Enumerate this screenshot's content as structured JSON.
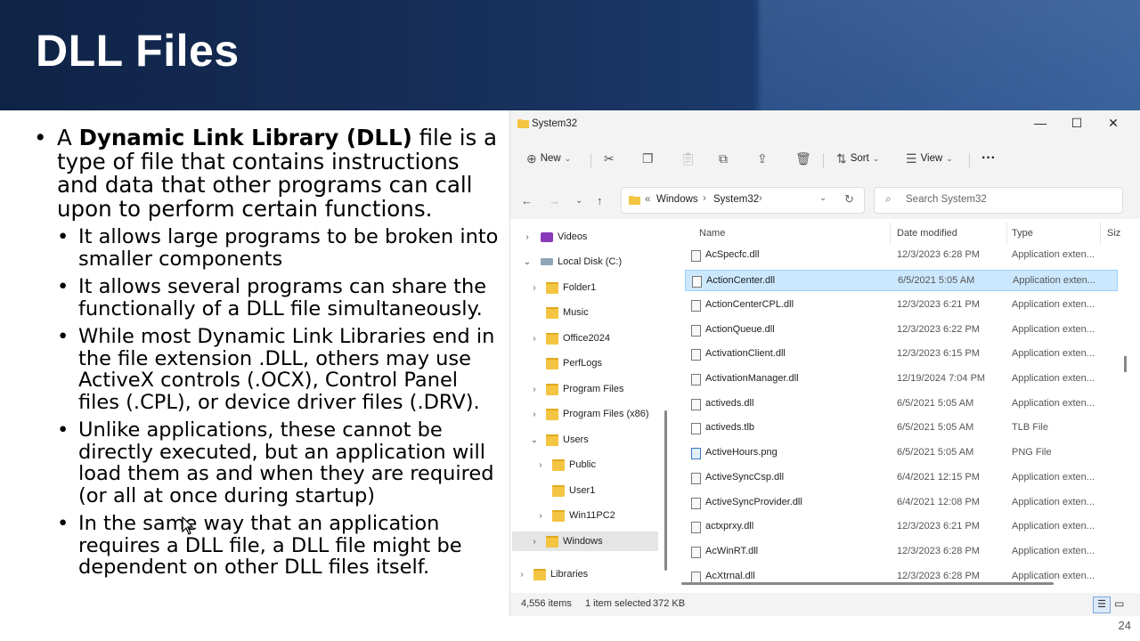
{
  "slide": {
    "title": "DLL Files",
    "page_number": "24",
    "bullets": [
      {
        "level": 1,
        "prefix": "A ",
        "bold": "Dynamic Link Library (DLL)",
        "text": " file is a type of file that contains instructions and data that other programs can call upon to perform certain functions."
      },
      {
        "level": 2,
        "text": "It allows large programs to be broken into smaller components"
      },
      {
        "level": 2,
        "text": "It allows several programs can share the functionally of a DLL file simultaneously."
      },
      {
        "level": 2,
        "text": "While most Dynamic Link Libraries end in the file extension .DLL, others may use ActiveX controls (.OCX), Control Panel files (.CPL), or device driver files (.DRV)."
      },
      {
        "level": 2,
        "text": "Unlike applications, these cannot be directly executed, but an application will load them as and when they are required (or all at once during startup)"
      },
      {
        "level": 2,
        "text": "In the same way that an application requires a DLL file, a DLL file might be dependent on other DLL files itself."
      }
    ]
  },
  "explorer": {
    "window_title": "System32",
    "toolbar": {
      "new": "New",
      "sort": "Sort",
      "view": "View",
      "more": "···"
    },
    "address": {
      "overflow": "«",
      "crumbs": [
        "Windows",
        "System32"
      ]
    },
    "search_placeholder": "Search System32",
    "tree": [
      {
        "label": "Videos",
        "depth": 0,
        "chev": "›",
        "icon": "video"
      },
      {
        "label": "Local Disk (C:)",
        "depth": 0,
        "chev": "⌄",
        "icon": "drive"
      },
      {
        "label": "Folder1",
        "depth": 1,
        "chev": "›",
        "icon": "folder"
      },
      {
        "label": "Music",
        "depth": 1,
        "chev": "",
        "icon": "folder"
      },
      {
        "label": "Office2024",
        "depth": 1,
        "chev": "›",
        "icon": "folder"
      },
      {
        "label": "PerfLogs",
        "depth": 1,
        "chev": "",
        "icon": "folder"
      },
      {
        "label": "Program Files",
        "depth": 1,
        "chev": "›",
        "icon": "folder"
      },
      {
        "label": "Program Files (x86)",
        "depth": 1,
        "chev": "›",
        "icon": "folder"
      },
      {
        "label": "Users",
        "depth": 1,
        "chev": "⌄",
        "icon": "folder"
      },
      {
        "label": "Public",
        "depth": 2,
        "chev": "›",
        "icon": "folder"
      },
      {
        "label": "User1",
        "depth": 2,
        "chev": "",
        "icon": "folder"
      },
      {
        "label": "Win11PC2",
        "depth": 2,
        "chev": "›",
        "icon": "folder"
      },
      {
        "label": "Windows",
        "depth": 1,
        "chev": "›",
        "icon": "folder",
        "selected": true
      },
      {
        "label": "Libraries",
        "depth": 0,
        "chev": "›",
        "icon": "folder"
      }
    ],
    "columns": [
      "Name",
      "Date modified",
      "Type",
      "Siz"
    ],
    "files": [
      {
        "name": "AcSpecfc.dll",
        "date": "12/3/2023 6:28 PM",
        "type": "Application exten..."
      },
      {
        "name": "ActionCenter.dll",
        "date": "6/5/2021 5:05 AM",
        "type": "Application exten...",
        "selected": true
      },
      {
        "name": "ActionCenterCPL.dll",
        "date": "12/3/2023 6:21 PM",
        "type": "Application exten..."
      },
      {
        "name": "ActionQueue.dll",
        "date": "12/3/2023 6:22 PM",
        "type": "Application exten..."
      },
      {
        "name": "ActivationClient.dll",
        "date": "12/3/2023 6:15 PM",
        "type": "Application exten..."
      },
      {
        "name": "ActivationManager.dll",
        "date": "12/19/2024 7:04 PM",
        "type": "Application exten..."
      },
      {
        "name": "activeds.dll",
        "date": "6/5/2021 5:05 AM",
        "type": "Application exten..."
      },
      {
        "name": "activeds.tlb",
        "date": "6/5/2021 5:05 AM",
        "type": "TLB File"
      },
      {
        "name": "ActiveHours.png",
        "date": "6/5/2021 5:05 AM",
        "type": "PNG File"
      },
      {
        "name": "ActiveSyncCsp.dll",
        "date": "6/4/2021 12:15 PM",
        "type": "Application exten..."
      },
      {
        "name": "ActiveSyncProvider.dll",
        "date": "6/4/2021 12:08 PM",
        "type": "Application exten..."
      },
      {
        "name": "actxprxy.dll",
        "date": "12/3/2023 6:21 PM",
        "type": "Application exten..."
      },
      {
        "name": "AcWinRT.dll",
        "date": "12/3/2023 6:28 PM",
        "type": "Application exten..."
      },
      {
        "name": "AcXtrnal.dll",
        "date": "12/3/2023 6:28 PM",
        "type": "Application exten..."
      }
    ],
    "status": {
      "items": "4,556 items",
      "selection": "1 item selected",
      "size": "372 KB"
    }
  }
}
